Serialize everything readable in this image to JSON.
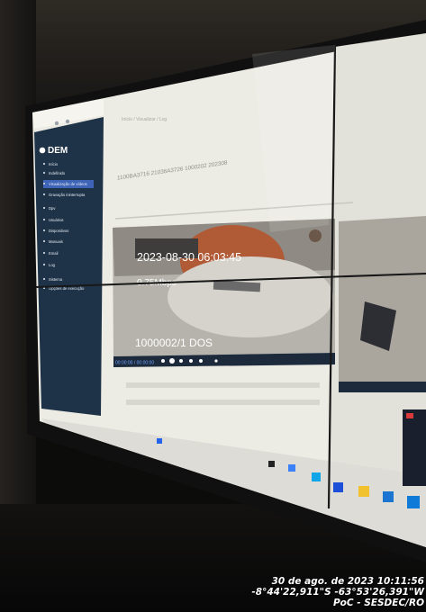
{
  "app": {
    "logo_text": "DEM",
    "breadcrumb": "Início / Visualizar / Log"
  },
  "sidebar": {
    "items": [
      {
        "label": "Início"
      },
      {
        "label": "Indefinido"
      },
      {
        "label": "Visualização de vídeos",
        "active": true
      },
      {
        "label": "Gravação ininterrupta"
      },
      {
        "label": "Dpv"
      },
      {
        "label": "Usuários"
      },
      {
        "label": "Dispositivos"
      },
      {
        "label": "Manuais"
      },
      {
        "label": "Email"
      },
      {
        "label": "Log"
      },
      {
        "label": "Sistema"
      },
      {
        "label": "Opções de execução"
      }
    ]
  },
  "main": {
    "device_id": "1100BA3716 21036A3726 1000202 202308"
  },
  "video": {
    "timestamp": "2023-08-30 06:03:45",
    "rate": "0.75Mbps",
    "channel_name": "1000002/1 DOS",
    "ctrl_time": "00:00:00 / 00:00:00"
  },
  "stamp": {
    "date": "30 de ago. de 2023 10:11:56",
    "coords": "-8°44'22,911\"S -63°53'26,391\"W",
    "org": "PoC - SESDEC/RO"
  },
  "colors": {
    "sidebar_bg": "#1f3348",
    "sidebar_active": "#3e64b8",
    "accent": "#3a66d6",
    "screen_bg": "#ecebe4"
  }
}
